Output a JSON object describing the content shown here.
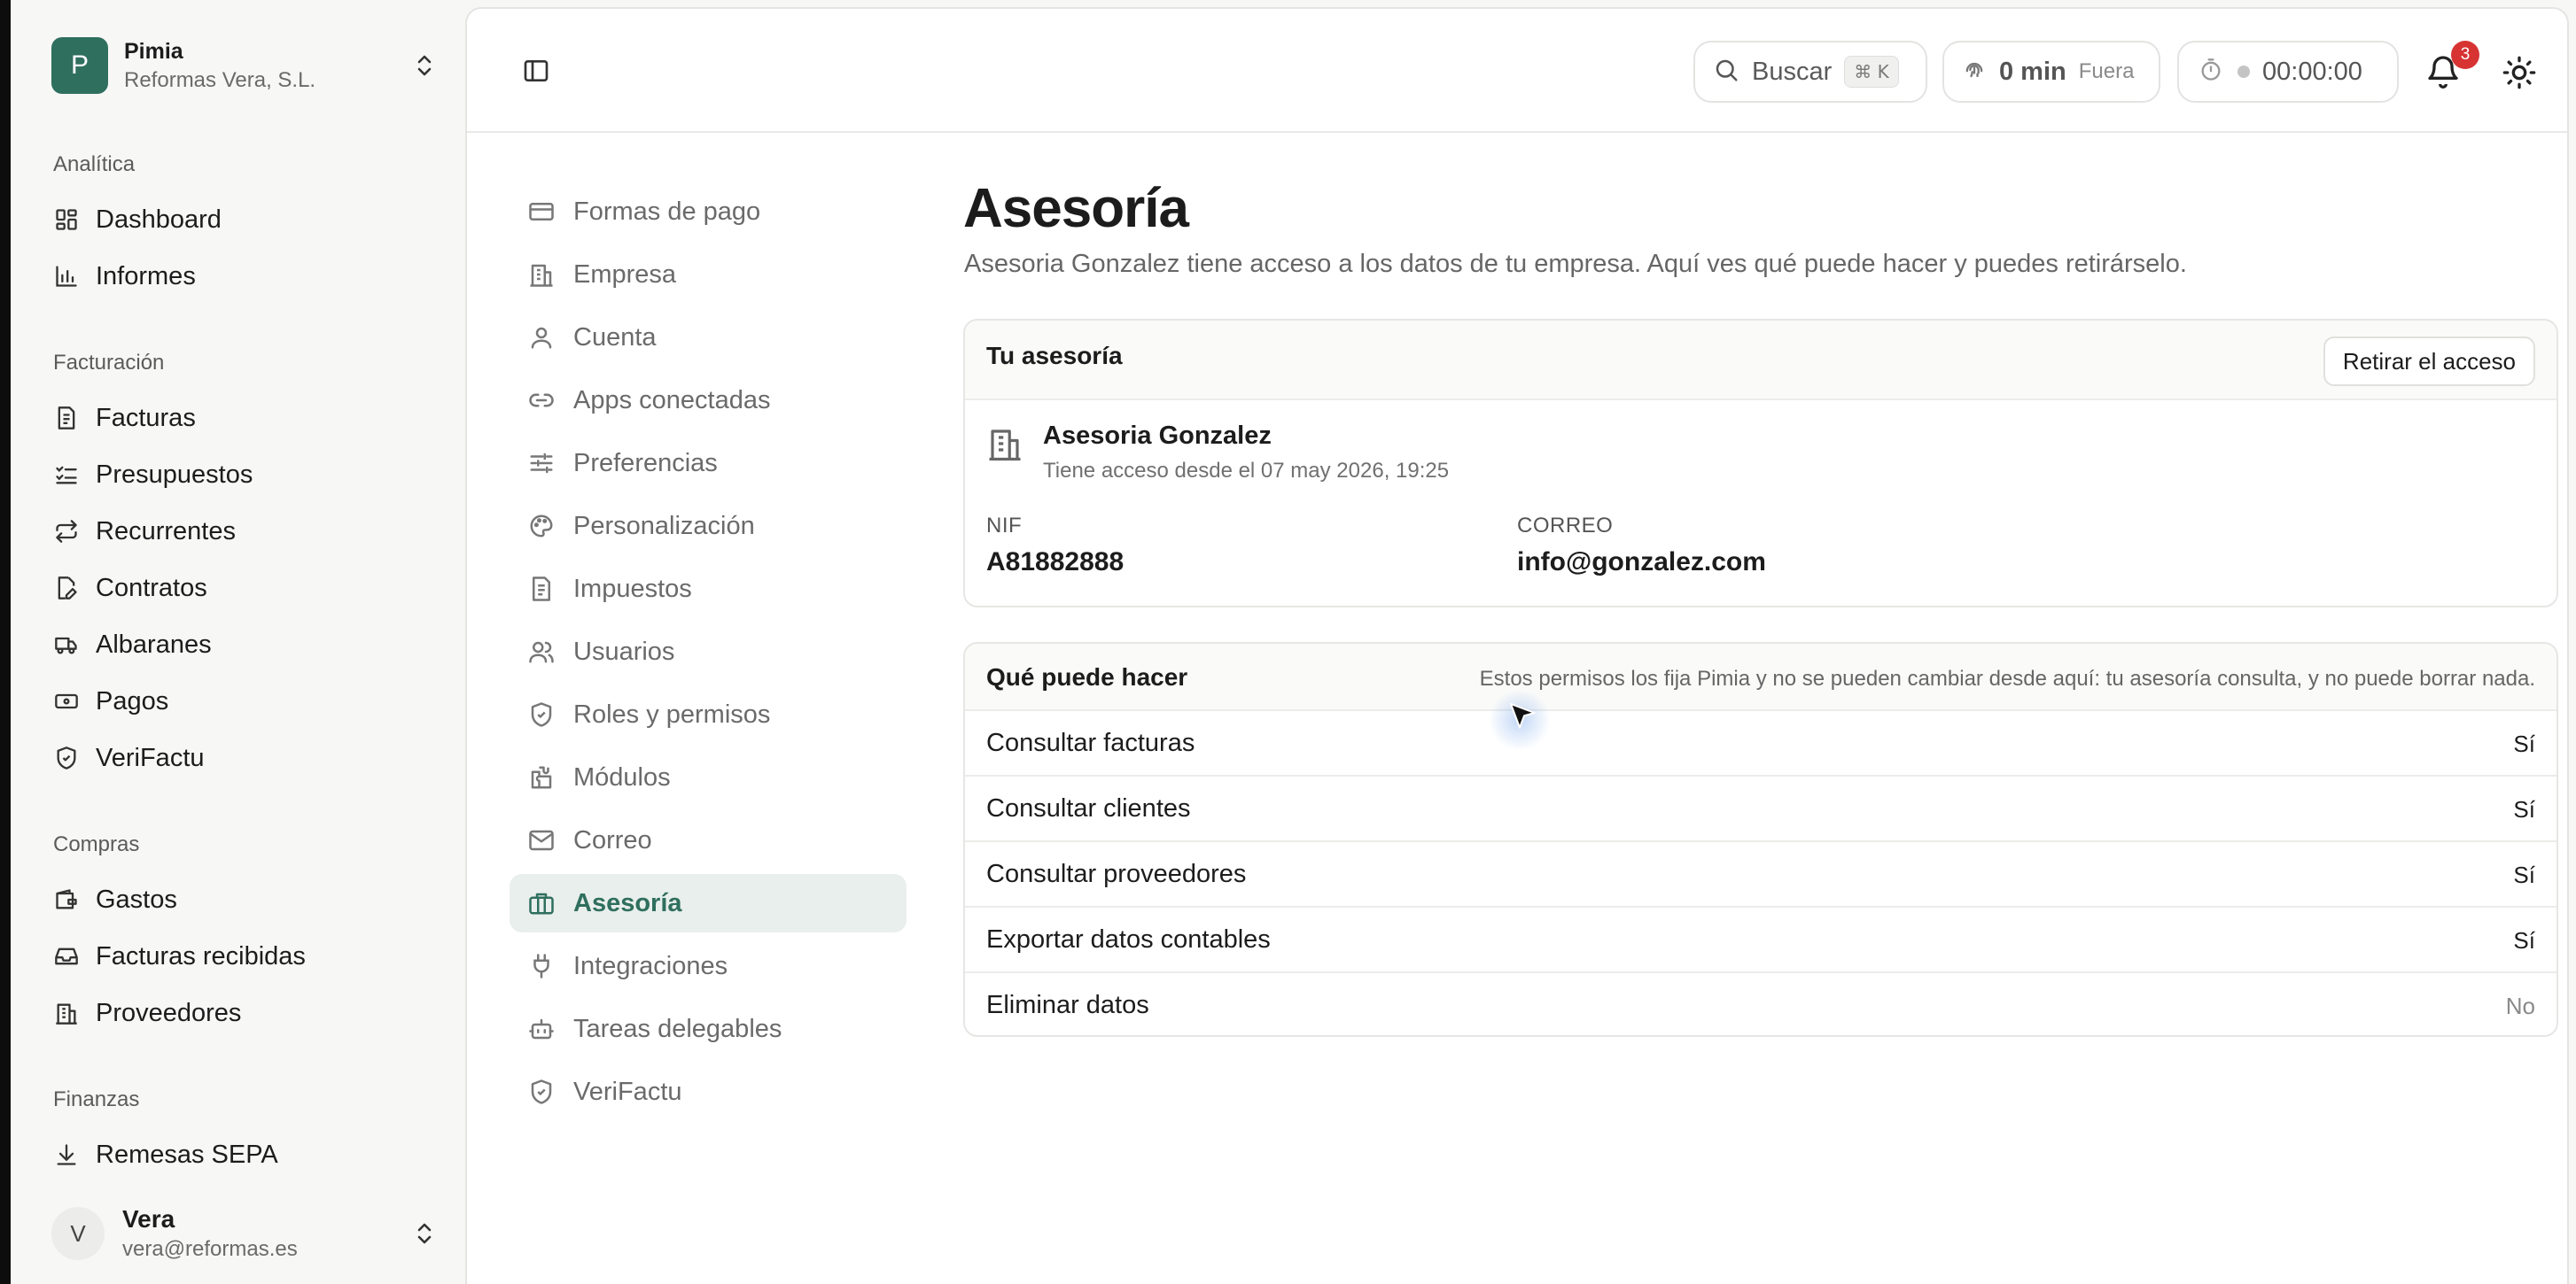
{
  "org": {
    "initial": "P",
    "name": "Pimia",
    "company": "Reformas Vera, S.L."
  },
  "sidebar": {
    "sections": [
      {
        "title": "Analítica",
        "items": [
          {
            "label": "Dashboard",
            "icon": "layout-grid-icon"
          },
          {
            "label": "Informes",
            "icon": "bar-chart-icon"
          }
        ]
      },
      {
        "title": "Facturación",
        "items": [
          {
            "label": "Facturas",
            "icon": "file-text-icon"
          },
          {
            "label": "Presupuestos",
            "icon": "list-checks-icon"
          },
          {
            "label": "Recurrentes",
            "icon": "repeat-icon"
          },
          {
            "label": "Contratos",
            "icon": "file-pen-icon"
          },
          {
            "label": "Albaranes",
            "icon": "truck-icon"
          },
          {
            "label": "Pagos",
            "icon": "banknote-icon"
          },
          {
            "label": "VeriFactu",
            "icon": "shield-check-icon"
          }
        ]
      },
      {
        "title": "Compras",
        "items": [
          {
            "label": "Gastos",
            "icon": "wallet-icon"
          },
          {
            "label": "Facturas recibidas",
            "icon": "inbox-icon"
          },
          {
            "label": "Proveedores",
            "icon": "building-icon"
          }
        ]
      },
      {
        "title": "Finanzas",
        "items": [
          {
            "label": "Remesas SEPA",
            "icon": "download-icon"
          }
        ]
      }
    ]
  },
  "user": {
    "initial": "V",
    "name": "Vera",
    "email": "vera@reformas.es"
  },
  "topbar": {
    "search_label": "Buscar",
    "search_shortcut": "⌘ K",
    "time_value": "0 min",
    "time_status": "Fuera",
    "timer_value": "00:00:00",
    "notifications_count": "3"
  },
  "settings_nav": [
    {
      "label": "Formas de pago",
      "icon": "credit-card-icon"
    },
    {
      "label": "Empresa",
      "icon": "building-icon"
    },
    {
      "label": "Cuenta",
      "icon": "user-icon"
    },
    {
      "label": "Apps conectadas",
      "icon": "link-icon"
    },
    {
      "label": "Preferencias",
      "icon": "sliders-icon"
    },
    {
      "label": "Personalización",
      "icon": "palette-icon"
    },
    {
      "label": "Impuestos",
      "icon": "file-text-icon"
    },
    {
      "label": "Usuarios",
      "icon": "users-icon"
    },
    {
      "label": "Roles y permisos",
      "icon": "shield-icon"
    },
    {
      "label": "Módulos",
      "icon": "puzzle-icon"
    },
    {
      "label": "Correo",
      "icon": "mail-icon"
    },
    {
      "label": "Asesoría",
      "icon": "briefcase-icon",
      "active": true
    },
    {
      "label": "Integraciones",
      "icon": "plug-icon"
    },
    {
      "label": "Tareas delegables",
      "icon": "bot-icon"
    },
    {
      "label": "VeriFactu",
      "icon": "shield-check-icon"
    }
  ],
  "page": {
    "title": "Asesoría",
    "description": "Asesoria Gonzalez tiene acceso a los datos de tu empresa. Aquí ves qué puede hacer y puedes retirárselo."
  },
  "advisor_card": {
    "title": "Tu asesoría",
    "revoke_label": "Retirar el acceso",
    "name": "Asesoria Gonzalez",
    "since": "Tiene acceso desde el 07 may 2026, 19:25",
    "nif_label": "NIF",
    "nif_value": "A81882888",
    "email_label": "CORREO",
    "email_value": "info@gonzalez.com"
  },
  "permissions": {
    "title": "Qué puede hacer",
    "note": "Estos permisos los fija Pimia y no se pueden cambiar desde aquí: tu asesoría consulta, y no puede borrar nada.",
    "rows": [
      {
        "name": "Consultar facturas",
        "value": "Sí"
      },
      {
        "name": "Consultar clientes",
        "value": "Sí"
      },
      {
        "name": "Consultar proveedores",
        "value": "Sí"
      },
      {
        "name": "Exportar datos contables",
        "value": "Sí"
      },
      {
        "name": "Eliminar datos",
        "value": "No"
      }
    ]
  },
  "colors": {
    "accent": "#2f6f5e",
    "active_bg": "#e9efec",
    "badge": "#d73333"
  }
}
